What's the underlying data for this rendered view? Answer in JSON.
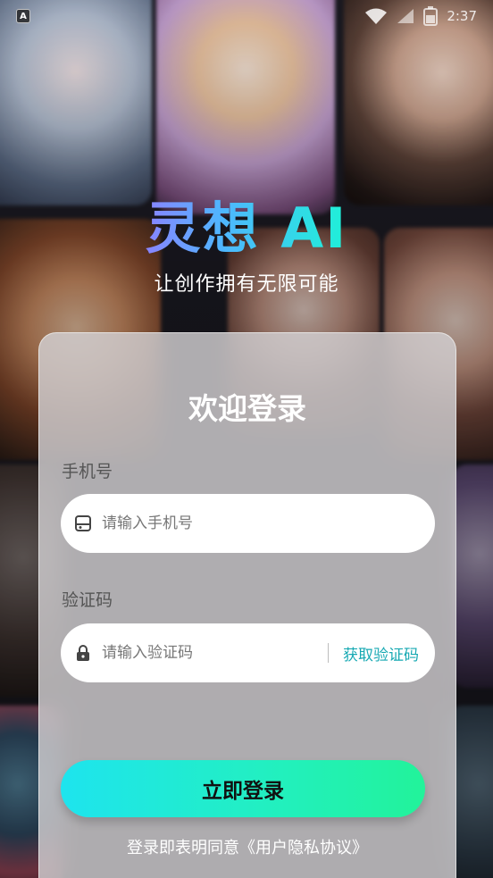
{
  "status_bar": {
    "app_icon_letter": "A",
    "time": "2:37",
    "icons": [
      "app-notification-icon",
      "wifi-icon",
      "signal-icon",
      "battery-icon"
    ]
  },
  "brand": {
    "title": "灵想 AI",
    "slogan": "让创作拥有无限可能"
  },
  "login": {
    "heading": "欢迎登录",
    "phone": {
      "label": "手机号",
      "placeholder": "请输入手机号",
      "value": "",
      "icon": "phone-icon"
    },
    "code": {
      "label": "验证码",
      "placeholder": "请输入验证码",
      "value": "",
      "icon": "lock-icon",
      "get_code_label": "获取验证码"
    },
    "submit_label": "立即登录",
    "agreement_text": "登录即表明同意《用户隐私协议》"
  },
  "colors": {
    "accent": "#17a9b3",
    "button_gradient_start": "#1ee4ee",
    "button_gradient_end": "#22f39a",
    "card_bg": "#d2d0d2"
  }
}
